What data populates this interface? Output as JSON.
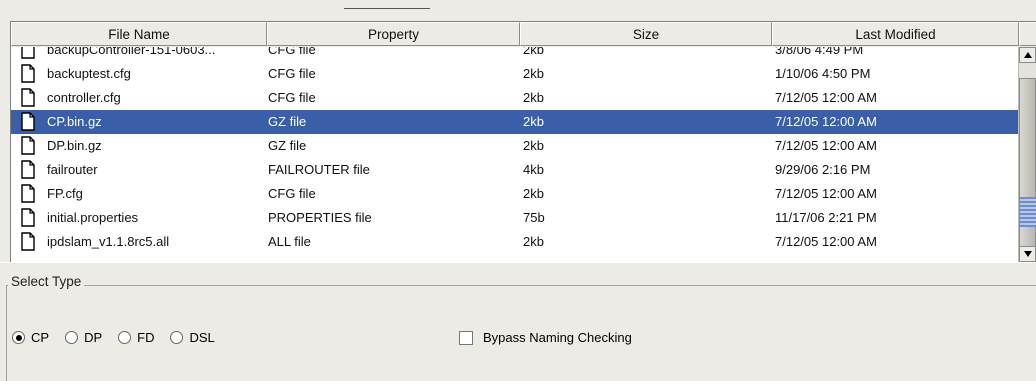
{
  "table": {
    "columns": [
      "File Name",
      "Property",
      "Size",
      "Last Modified"
    ],
    "rows": [
      {
        "name": "backupController-151-0603...",
        "property": "CFG file",
        "size": "2kb",
        "modified": "3/8/06 4:49 PM"
      },
      {
        "name": "backuptest.cfg",
        "property": "CFG file",
        "size": "2kb",
        "modified": "1/10/06 4:50 PM"
      },
      {
        "name": "controller.cfg",
        "property": "CFG file",
        "size": "2kb",
        "modified": "7/12/05 12:00 AM"
      },
      {
        "name": "CP.bin.gz",
        "property": "GZ file",
        "size": "2kb",
        "modified": "7/12/05 12:00 AM"
      },
      {
        "name": "DP.bin.gz",
        "property": "GZ file",
        "size": "2kb",
        "modified": "7/12/05 12:00 AM"
      },
      {
        "name": "failrouter",
        "property": "FAILROUTER file",
        "size": "4kb",
        "modified": "9/29/06 2:16 PM"
      },
      {
        "name": "FP.cfg",
        "property": "CFG file",
        "size": "2kb",
        "modified": "7/12/05 12:00 AM"
      },
      {
        "name": "initial.properties",
        "property": "PROPERTIES file",
        "size": "75b",
        "modified": "11/17/06 2:21 PM"
      },
      {
        "name": "ipdslam_v1.1.8rc5.all",
        "property": "ALL file",
        "size": "2kb",
        "modified": "7/12/05 12:00 AM"
      }
    ],
    "selected_index": 3
  },
  "select_type": {
    "title": "Select Type",
    "options": [
      {
        "label": "CP",
        "selected": true
      },
      {
        "label": "DP",
        "selected": false
      },
      {
        "label": "FD",
        "selected": false
      },
      {
        "label": "DSL",
        "selected": false
      }
    ]
  },
  "bypass": {
    "label": "Bypass Naming Checking",
    "checked": false
  },
  "colors": {
    "selection": "#3a5ea8",
    "background": "#ecebe6"
  },
  "icons": {
    "file": "file-icon",
    "scroll_up": "arrow-up-icon",
    "scroll_down": "arrow-down-icon"
  }
}
